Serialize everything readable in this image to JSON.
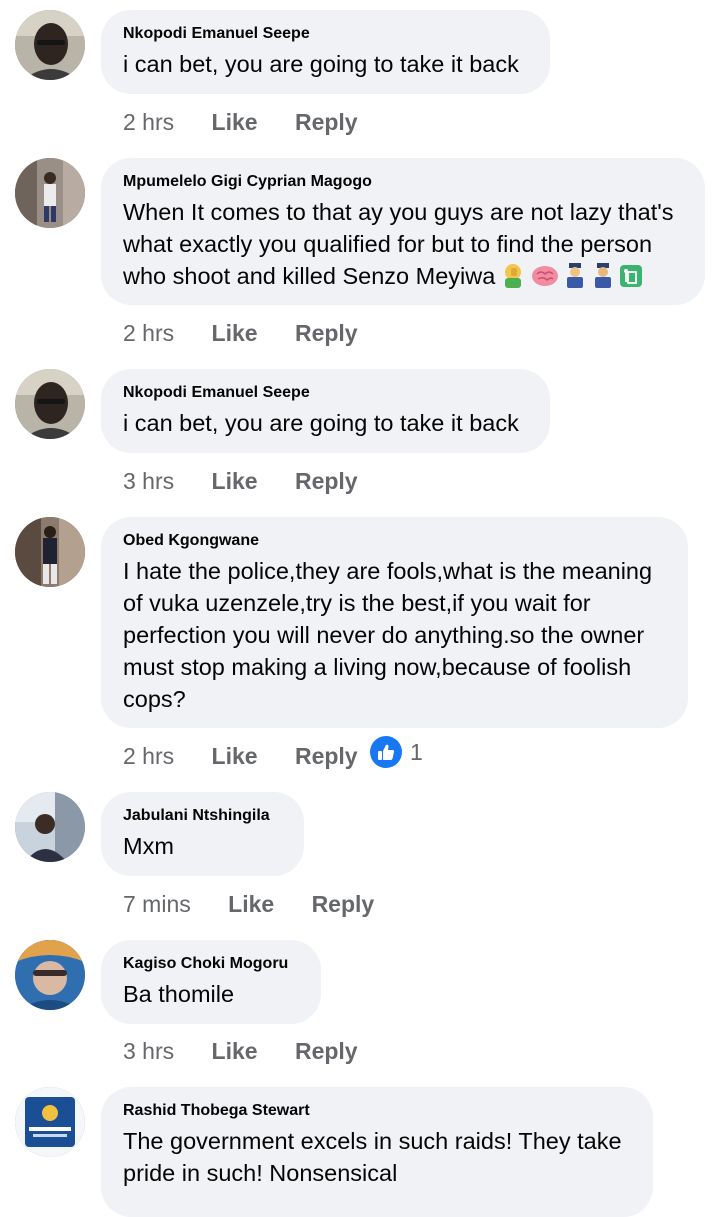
{
  "comments": [
    {
      "author": "Nkopodi Emanuel Seepe",
      "text": "i can bet, you are going to take it back",
      "time": "2 hrs",
      "like_label": "Like",
      "reply_label": "Reply"
    },
    {
      "author": "Mpumelelo Gigi Cyprian Magogo",
      "text_lines": [
        "When It comes to that ay you guys are not lazy that's",
        "what exactly you qualified for but to find the person",
        "who shoot and killed Senzo Meyiwa"
      ],
      "emojis": [
        "facepalm-emoji",
        "brain-emoji",
        "police-officer-emoji",
        "police-officer-emoji",
        "trash-bin-emoji"
      ],
      "time": "2 hrs",
      "like_label": "Like",
      "reply_label": "Reply"
    },
    {
      "author": "Nkopodi Emanuel Seepe",
      "text": "i can bet, you are going to take it back",
      "time": "3 hrs",
      "like_label": "Like",
      "reply_label": "Reply"
    },
    {
      "author": "Obed Kgongwane",
      "text_lines": [
        "I hate the police,they are fools,what is the meaning",
        "of vuka uzenzele,try is the best,if you wait for",
        "perfection you will never do anything.so the owner",
        "must stop making a living now,because of foolish",
        "cops?"
      ],
      "time": "2 hrs",
      "like_label": "Like",
      "reply_label": "Reply",
      "reaction_count": "1"
    },
    {
      "author": "Jabulani Ntshingila",
      "text": "Mxm",
      "time": "7 mins",
      "like_label": "Like",
      "reply_label": "Reply"
    },
    {
      "author": "Kagiso Choki Mogoru",
      "text": "Ba thomile",
      "time": "3 hrs",
      "like_label": "Like",
      "reply_label": "Reply"
    },
    {
      "author": "Rashid Thobega Stewart",
      "text_lines": [
        "The government excels in such raids! They take",
        "pride in such! Nonsensical"
      ]
    }
  ],
  "colors": {
    "bubble": "#f0f2f5",
    "meta_text": "#65676b",
    "like_blue": "#1877f2"
  }
}
